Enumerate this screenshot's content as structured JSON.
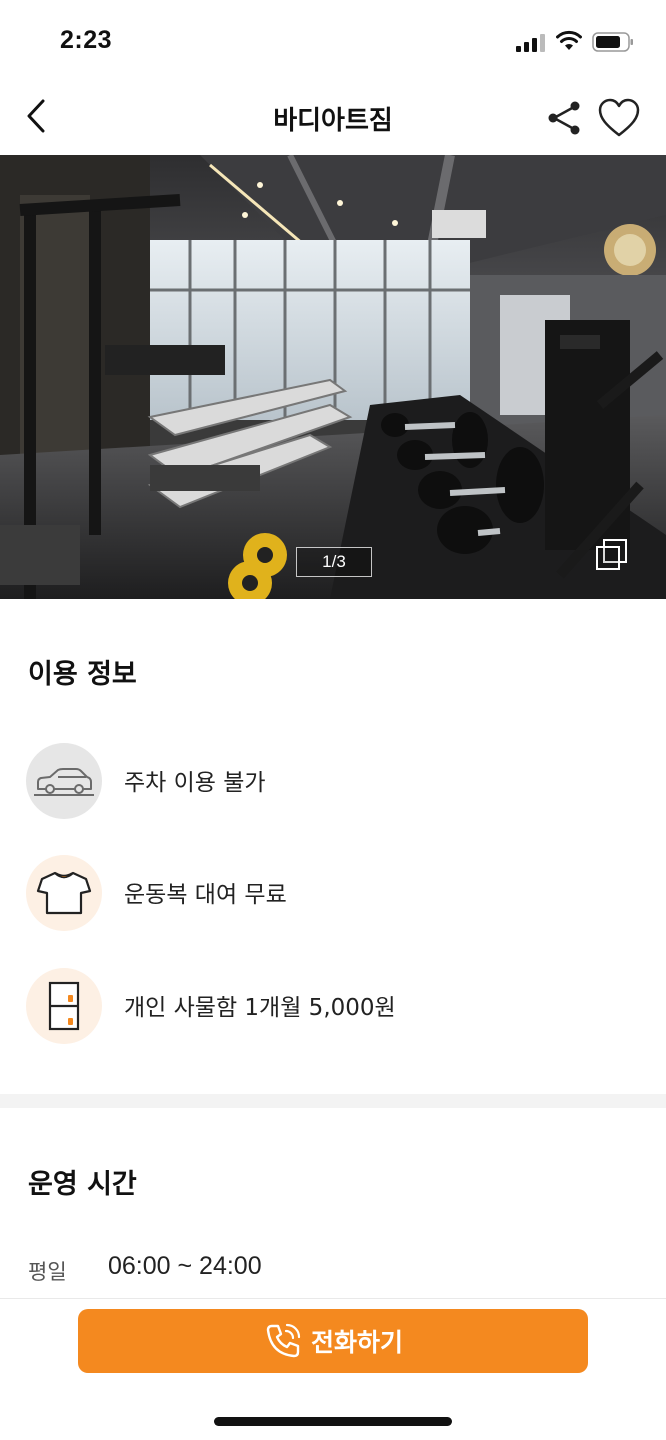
{
  "status_bar": {
    "time": "2:23",
    "icons": [
      "cellular-signal-icon",
      "wifi-icon",
      "battery-icon"
    ]
  },
  "header": {
    "title": "바디아트짐",
    "back_icon": "chevron-left-icon",
    "share_icon": "share-icon",
    "favorite_icon": "heart-outline-icon"
  },
  "hero": {
    "photo_index_label": "1/3",
    "gallery_icon": "gallery-stack-icon"
  },
  "usage_info": {
    "title": "이용 정보",
    "items": [
      {
        "icon": "car-icon",
        "text": "주차 이용 불가"
      },
      {
        "icon": "tshirt-icon",
        "text": "운동복 대여 무료"
      },
      {
        "icon": "locker-icon",
        "text": "개인 사물함 1개월 5,000원"
      }
    ]
  },
  "hours": {
    "title": "운영 시간",
    "rows": [
      {
        "label": "평일",
        "value": "06:00 ~ 24:00"
      }
    ]
  },
  "bottom_bar": {
    "call_label": "전화하기",
    "call_icon": "phone-icon"
  },
  "colors": {
    "accent": "#f4891f",
    "icon_gray_bg": "#e6e6e6",
    "icon_peach_bg": "#fdf0e4",
    "divider": "#f3f3f3"
  }
}
